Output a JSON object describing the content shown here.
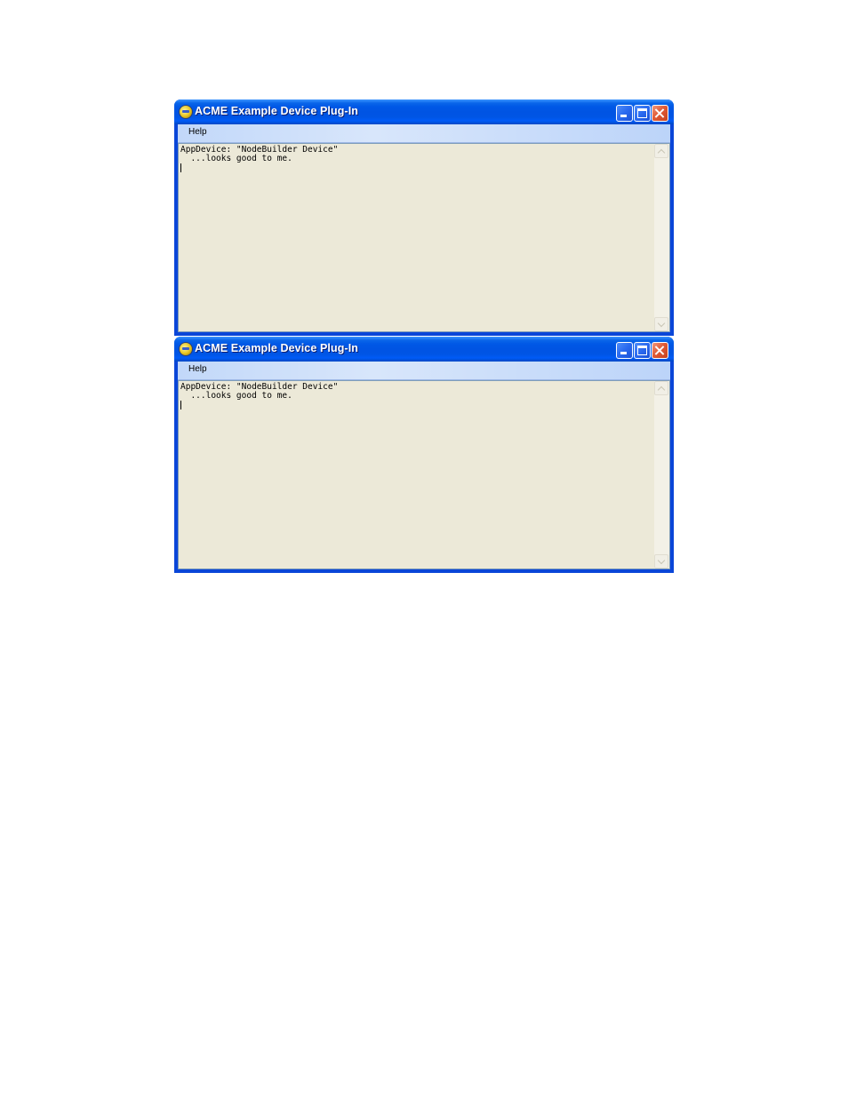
{
  "windows": [
    {
      "title": "ACME Example Device Plug-In",
      "menu": {
        "help_label": "Help"
      },
      "output": {
        "line1": "AppDevice: \"NodeBuilder Device\"",
        "line2": "  ...looks good to me."
      }
    },
    {
      "title": "ACME Example Device Plug-In",
      "menu": {
        "help_label": "Help"
      },
      "output": {
        "line1": "AppDevice: \"NodeBuilder Device\"",
        "line2": "  ...looks good to me."
      }
    }
  ],
  "icons": {
    "app": "app-icon",
    "minimize": "minimize-icon",
    "maximize": "maximize-icon",
    "close": "close-icon",
    "scroll_up": "chevron-up-icon",
    "scroll_down": "chevron-down-icon"
  },
  "colors": {
    "titlebar": "#0054e3",
    "menubar": "#c2d8f9",
    "textarea_background": "#ece9d8",
    "close_button": "#e15a36",
    "window_frame": "#0a46d8"
  }
}
